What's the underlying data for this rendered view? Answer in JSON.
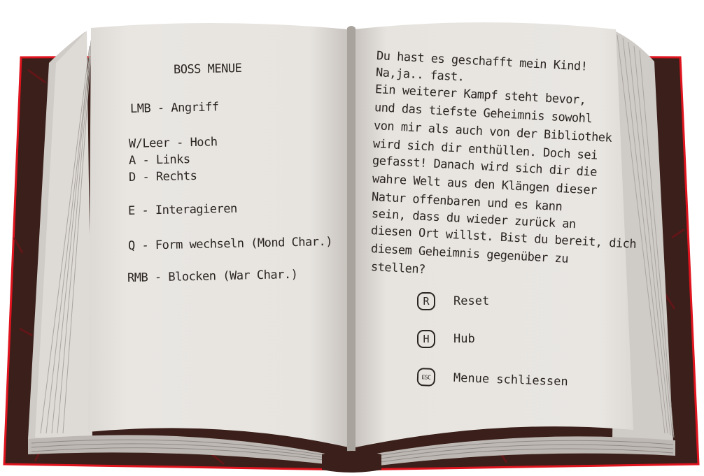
{
  "colors": {
    "cover": "#3a1f1a",
    "cover_edge": "#e0141e",
    "page": "#e8e5e1",
    "page_shadow": "#c9c5c1",
    "ink": "#2b2522"
  },
  "left_page": {
    "title": "BOSS MENUE",
    "controls": [
      "LMB - Angriff",
      "W/Leer - Hoch",
      "A - Links",
      "D - Rechts",
      "E - Interagieren",
      "Q - Form wechseln (Mond Char.)",
      "RMB - Blocken (War Char.)"
    ]
  },
  "right_page": {
    "story_lines": [
      "Du hast es geschafft mein Kind!",
      "Na,ja.. fast.",
      "Ein weiterer Kampf steht bevor,",
      "und das tiefste Geheimnis sowohl",
      "von mir als auch von der Bibliothek",
      "wird sich dir enthüllen. Doch sei",
      "gefasst! Danach wird sich dir die",
      "wahre Welt aus den Klängen dieser",
      "Natur offenbaren und es kann",
      "sein, dass du wieder zurück an",
      "diesen Ort willst. Bist du bereit, dich",
      "diesem Geheimnis gegenüber zu",
      "stellen?"
    ],
    "options": [
      {
        "key": "R",
        "label": "Reset",
        "icon": "r-key-icon"
      },
      {
        "key": "H",
        "label": "Hub",
        "icon": "h-key-icon"
      },
      {
        "key": "ESC",
        "label": "Menue schliessen",
        "icon": "esc-key-icon"
      }
    ]
  }
}
